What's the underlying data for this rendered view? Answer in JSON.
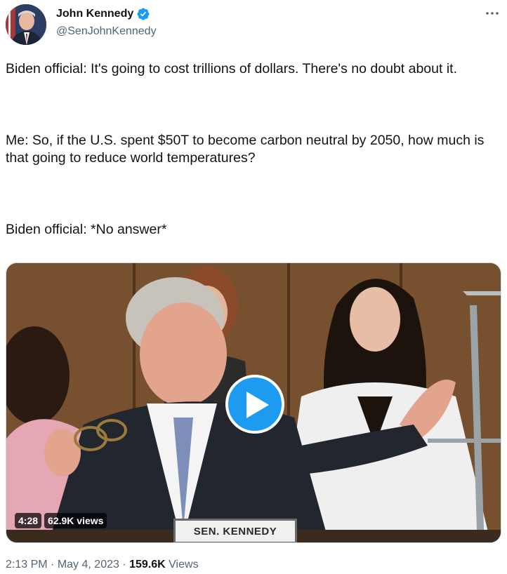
{
  "author": {
    "display_name": "John Kennedy",
    "handle": "@SenJohnKennedy",
    "verified_icon": "verified-badge-icon",
    "avatar_icon": "profile-photo"
  },
  "tweet": {
    "paragraphs": [
      "Biden official: It's going to cost trillions of dollars. There's no doubt about it.",
      "Me: So, if the U.S. spent $50T to become carbon neutral by 2050, how much is that going to reduce world temperatures?",
      "Biden official: *No answer*"
    ]
  },
  "media": {
    "duration": "4:28",
    "views": "62.9K views",
    "nameplate": "SEN. KENNEDY",
    "play_icon": "play-icon"
  },
  "meta": {
    "time": "2:13 PM",
    "separator": "·",
    "date": "May 4, 2023",
    "views_count": "159.6K",
    "views_label": "Views"
  },
  "colors": {
    "accent": "#1d9bf0",
    "text_primary": "#0f1419",
    "text_secondary": "#536471"
  }
}
